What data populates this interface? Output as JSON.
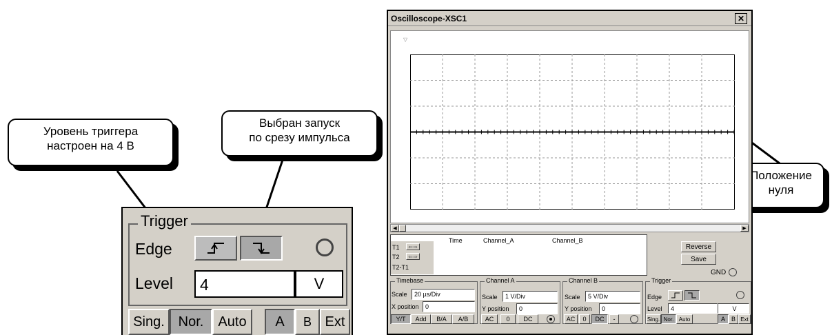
{
  "callouts": {
    "trigger_level": {
      "line1": "Уровень триггера",
      "line2": "настроен на 4 В"
    },
    "falling_edge": {
      "line1": "Выбран запуск",
      "line2": "по срезу импульса"
    },
    "zero_position": {
      "line1": "Положение",
      "line2": "нуля"
    }
  },
  "zoom_trigger": {
    "title": "Trigger",
    "edge_label": "Edge",
    "level_label": "Level",
    "level_value": "4",
    "level_unit": "V",
    "modes": [
      "Sing.",
      "Nor.",
      "Auto"
    ],
    "sources": [
      "A",
      "B",
      "Ext"
    ]
  },
  "window": {
    "title": "Oscilloscope-XSC1",
    "close_glyph": "✕",
    "readout": {
      "headers": [
        "Time",
        "Channel_A",
        "Channel_B"
      ],
      "rows": [
        "T1",
        "T2",
        "T2-T1"
      ],
      "cursor_arrows": "⇐⇒"
    },
    "reverse_label": "Reverse",
    "save_label": "Save",
    "gnd_label": "GND",
    "timebase": {
      "title": "Timebase",
      "scale_label": "Scale",
      "scale_value": "20 µs/Div",
      "xpos_label": "X position",
      "xpos_value": "0",
      "buttons": [
        "Y/T",
        "Add",
        "B/A",
        "A/B"
      ]
    },
    "channel_a": {
      "title": "Channel A",
      "scale_label": "Scale",
      "scale_value": "1  V/Div",
      "ypos_label": "Y position",
      "ypos_value": "0",
      "buttons": [
        "AC",
        "0",
        "DC"
      ]
    },
    "channel_b": {
      "title": "Channel B",
      "scale_label": "Scale",
      "scale_value": "5  V/Div",
      "ypos_label": "Y position",
      "ypos_value": "0",
      "buttons": [
        "AC",
        "0",
        "DC",
        "-"
      ]
    },
    "trigger": {
      "title": "Trigger",
      "edge_label": "Edge",
      "level_label": "Level",
      "level_value": "4",
      "level_unit": "V",
      "modes": [
        "Sing.",
        "Nor.",
        "Auto"
      ],
      "sources": [
        "A",
        "B",
        "Ext"
      ]
    }
  }
}
